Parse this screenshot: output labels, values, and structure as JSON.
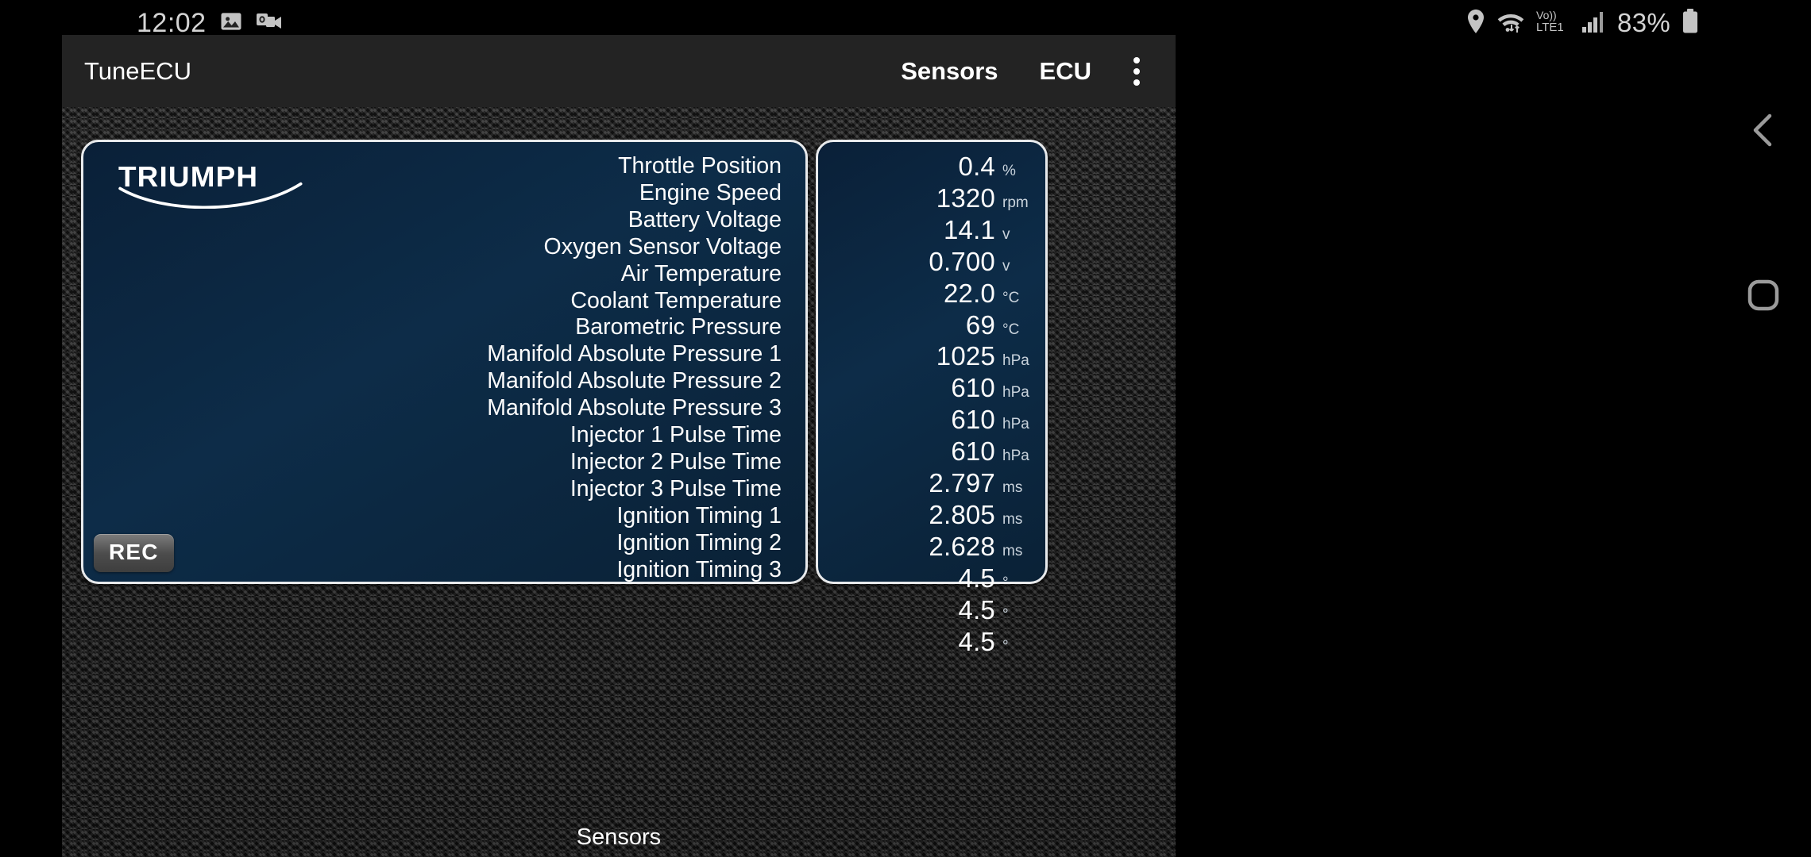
{
  "statusbar": {
    "clock": "12:02",
    "left_icons": [
      "gallery-icon",
      "outlook-video-icon"
    ],
    "right_icons": [
      "location-icon",
      "wifi-icon",
      "volte-icon",
      "signal-icon"
    ],
    "network_label": "Vo))",
    "network_sub": "LTE1",
    "battery_percent": "83%"
  },
  "app": {
    "title": "TuneECU",
    "actions": {
      "sensors": "Sensors",
      "ecu": "ECU",
      "overflow": "overflow-menu"
    },
    "brand_logo": "TRIUMPH",
    "rec_button": "REC",
    "bottom_label": "Sensors"
  },
  "navbar": {
    "back": "back-icon",
    "home": "home-icon"
  },
  "colors": {
    "panel_bg": "#0d2c48",
    "panel_border": "#e8eaec",
    "appbar_bg": "#232323",
    "text": "#fdfdfd",
    "unit_text": "#c9d3dc",
    "statusbar_icon": "#c4c4c4"
  },
  "sensors": [
    {
      "label": "Throttle Position",
      "value": "0.4",
      "unit": "%"
    },
    {
      "label": "Engine Speed",
      "value": "1320",
      "unit": "rpm"
    },
    {
      "label": "Battery Voltage",
      "value": "14.1",
      "unit": "v"
    },
    {
      "label": "Oxygen Sensor Voltage",
      "value": "0.700",
      "unit": "v"
    },
    {
      "label": "Air Temperature",
      "value": "22.0",
      "unit": "°C"
    },
    {
      "label": "Coolant Temperature",
      "value": "69",
      "unit": "°C"
    },
    {
      "label": "Barometric Pressure",
      "value": "1025",
      "unit": "hPa"
    },
    {
      "label": "Manifold Absolute Pressure 1",
      "value": "610",
      "unit": "hPa"
    },
    {
      "label": "Manifold Absolute Pressure 2",
      "value": "610",
      "unit": "hPa"
    },
    {
      "label": "Manifold Absolute Pressure 3",
      "value": "610",
      "unit": "hPa"
    },
    {
      "label": "Injector 1 Pulse Time",
      "value": "2.797",
      "unit": "ms"
    },
    {
      "label": "Injector 2 Pulse Time",
      "value": "2.805",
      "unit": "ms"
    },
    {
      "label": "Injector 3 Pulse Time",
      "value": "2.628",
      "unit": "ms"
    },
    {
      "label": "Ignition Timing 1",
      "value": "4.5",
      "unit": "°"
    },
    {
      "label": "Ignition Timing 2",
      "value": "4.5",
      "unit": "°"
    },
    {
      "label": "Ignition Timing 3",
      "value": "4.5",
      "unit": "°"
    }
  ]
}
